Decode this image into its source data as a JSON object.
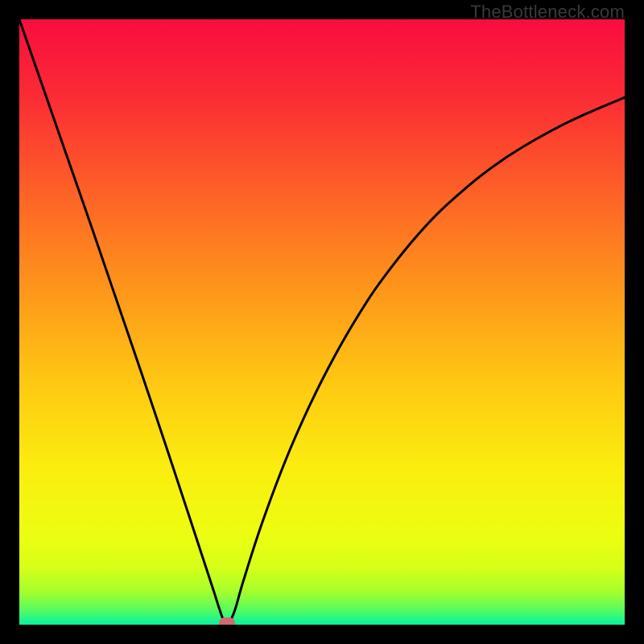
{
  "watermark": "TheBottleneck.com",
  "colors": {
    "frame": "#000000",
    "gradient_stops": [
      {
        "offset": 0.0,
        "color": "#f80d3f"
      },
      {
        "offset": 0.12,
        "color": "#fb2935"
      },
      {
        "offset": 0.28,
        "color": "#fd5f27"
      },
      {
        "offset": 0.44,
        "color": "#fe941b"
      },
      {
        "offset": 0.6,
        "color": "#fec812"
      },
      {
        "offset": 0.74,
        "color": "#fbed0f"
      },
      {
        "offset": 0.85,
        "color": "#edfd11"
      },
      {
        "offset": 0.905,
        "color": "#d7ff17"
      },
      {
        "offset": 0.945,
        "color": "#a7ff2c"
      },
      {
        "offset": 0.975,
        "color": "#59fb5f"
      },
      {
        "offset": 1.0,
        "color": "#05f4a1"
      }
    ],
    "curve": "#000000",
    "marker": "#cf6b6e"
  },
  "chart_data": {
    "type": "line",
    "title": "",
    "xlabel": "",
    "ylabel": "",
    "xlim": [
      0,
      100
    ],
    "ylim": [
      0,
      100
    ],
    "grid": false,
    "legend_position": "none",
    "series": [
      {
        "name": "bottleneck-curve",
        "x": [
          0,
          4,
          8,
          12,
          16,
          20,
          24,
          28,
          30,
          32,
          33.5,
          34.3,
          35.5,
          37,
          40,
          44,
          48,
          52,
          56,
          60,
          66,
          72,
          80,
          90,
          100
        ],
        "y": [
          100,
          88.5,
          77,
          65.5,
          53.8,
          42.1,
          30.2,
          18.1,
          12.0,
          5.9,
          1.3,
          0.0,
          2.1,
          7.2,
          16.5,
          27.2,
          36.3,
          44.2,
          51.1,
          57.1,
          64.6,
          70.6,
          76.9,
          82.7,
          87.1
        ]
      }
    ],
    "annotations": [
      {
        "name": "minimum-marker",
        "x": 34.3,
        "y": 0.0
      }
    ]
  }
}
